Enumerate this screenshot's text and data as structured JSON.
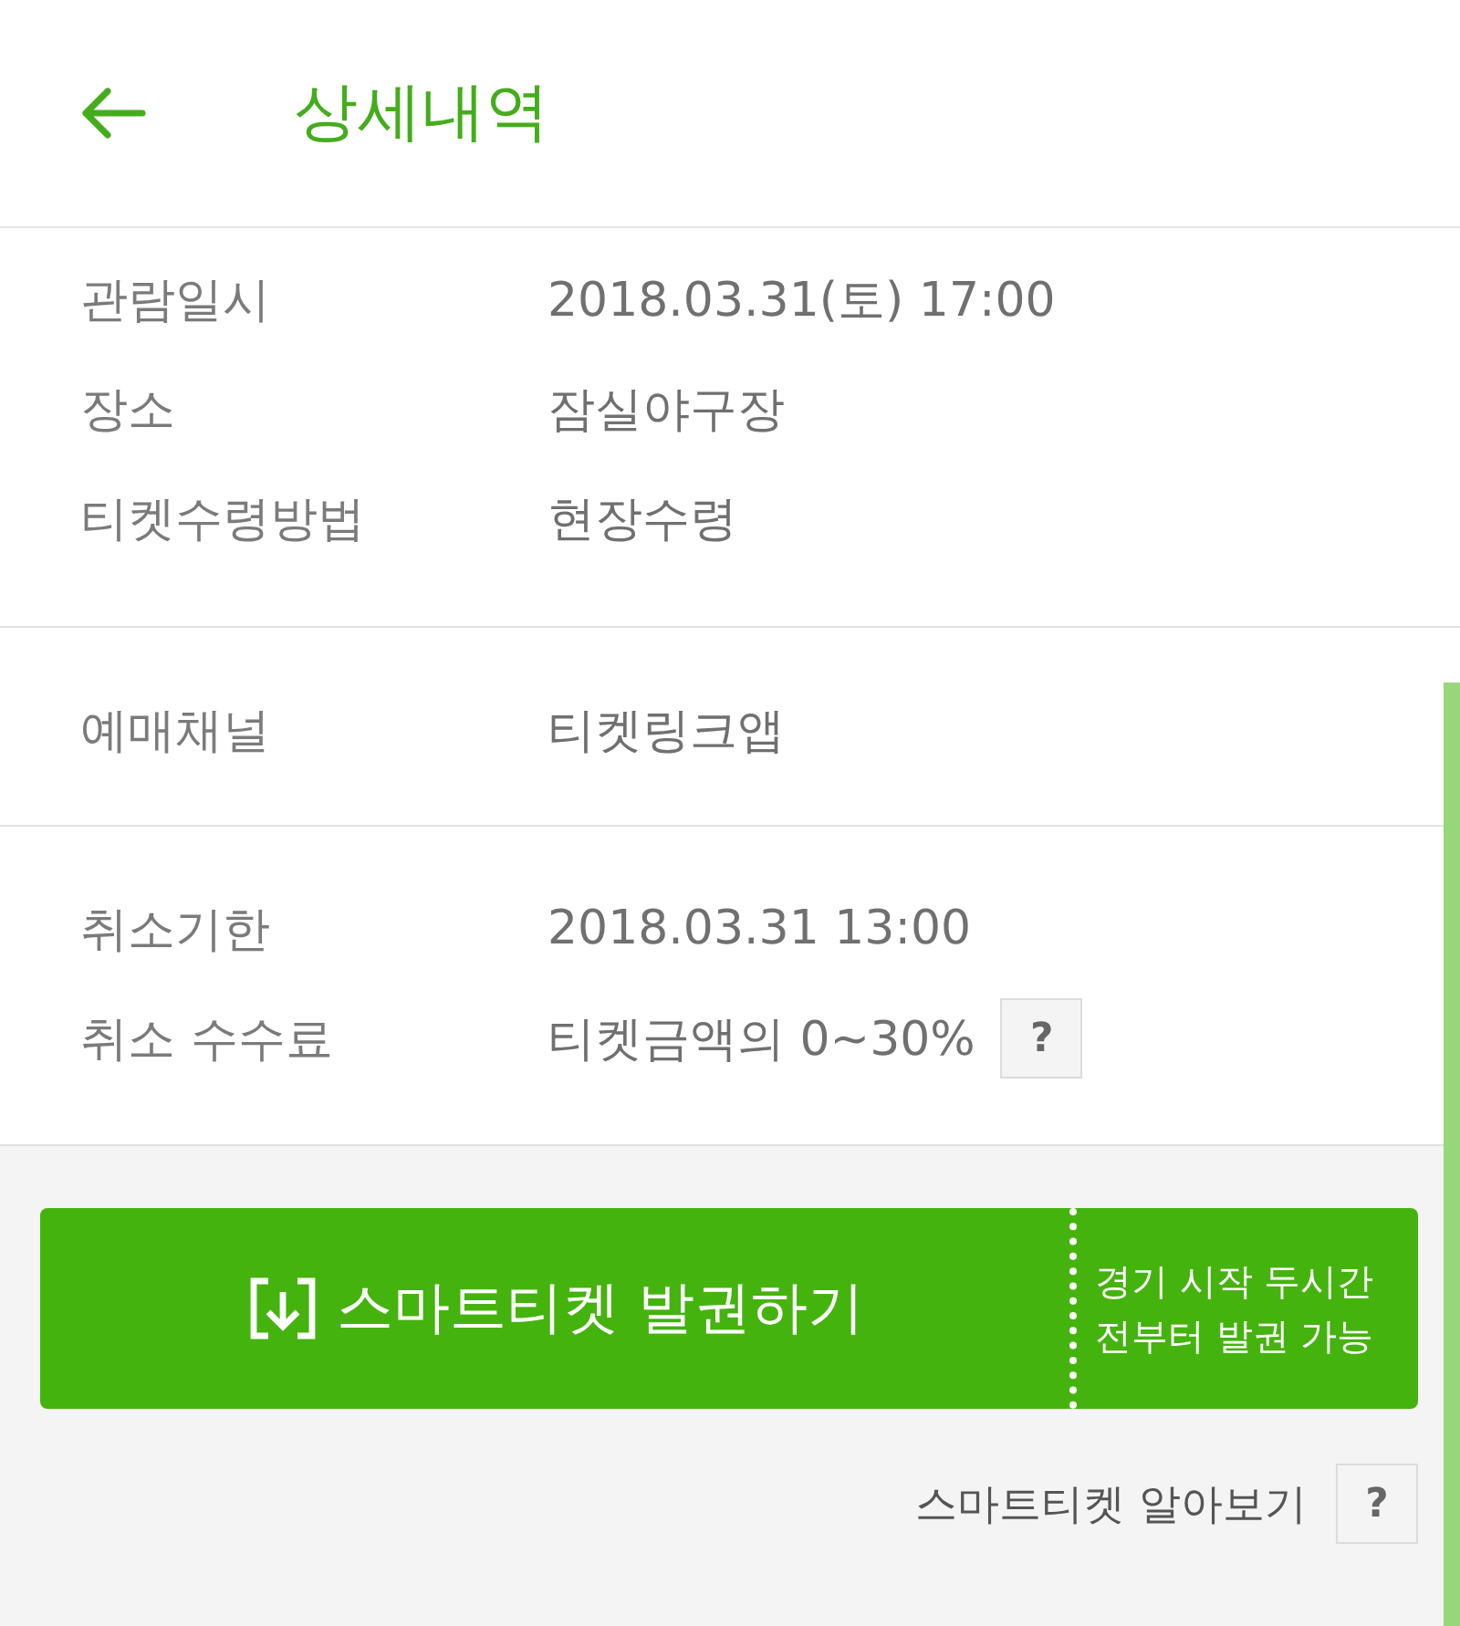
{
  "header": {
    "title": "상세내역"
  },
  "sections": [
    {
      "rows": [
        {
          "label": "관람일시",
          "value": "2018.03.31(토) 17:00"
        },
        {
          "label": "장소",
          "value": "잠실야구장"
        },
        {
          "label": "티켓수령방법",
          "value": "현장수령"
        }
      ]
    },
    {
      "rows": [
        {
          "label": "예매채널",
          "value": "티켓링크앱"
        }
      ]
    },
    {
      "rows": [
        {
          "label": "취소기한",
          "value": "2018.03.31 13:00"
        },
        {
          "label": "취소 수수료",
          "value": "티켓금액의 0~30%",
          "help_button": "?"
        }
      ]
    }
  ],
  "issue_button": {
    "label": "스마트티켓 발권하기",
    "note_lines": [
      "경기 시작 두시간",
      "전부터 발권 가능"
    ]
  },
  "smart_ticket_info": {
    "label": "스마트티켓 알아보기",
    "help_button": "?"
  }
}
